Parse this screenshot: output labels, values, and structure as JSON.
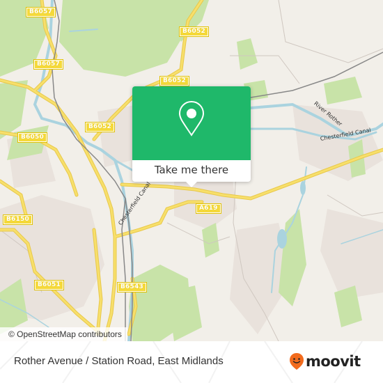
{
  "map": {
    "road_labels": [
      {
        "id": "b6057-top",
        "text": "B6057"
      },
      {
        "id": "b6057-mid",
        "text": "B6057"
      },
      {
        "id": "b6052-top-right",
        "text": "B6052"
      },
      {
        "id": "b6052-center",
        "text": "B6052"
      },
      {
        "id": "b6052-left",
        "text": "B6052"
      },
      {
        "id": "b6050",
        "text": "B6050"
      },
      {
        "id": "b6150",
        "text": "B6150"
      },
      {
        "id": "a619",
        "text": "A619"
      },
      {
        "id": "b6051",
        "text": "B6051"
      },
      {
        "id": "b6543",
        "text": "B6543"
      }
    ],
    "water_labels": [
      {
        "id": "river-rother",
        "text": "River Rother"
      },
      {
        "id": "chesterfield-canal-east",
        "text": "Chesterfield Canal"
      },
      {
        "id": "chesterfield-canal-west",
        "text": "Chesterfield Canal"
      }
    ],
    "attribution": "© OpenStreetMap contributors",
    "colors": {
      "land": "#f2efe9",
      "woodland": "#c8e3a8",
      "water": "#aad3df",
      "road": "#f7df6b",
      "rail": "#777777"
    }
  },
  "popup": {
    "icon": "location-pin-icon",
    "cta_label": "Take me there",
    "accent_color": "#1fb86a"
  },
  "footer": {
    "title": "Rother Avenue / Station Road, East Midlands",
    "brand": "moovit",
    "brand_color": "#f26b1d"
  }
}
